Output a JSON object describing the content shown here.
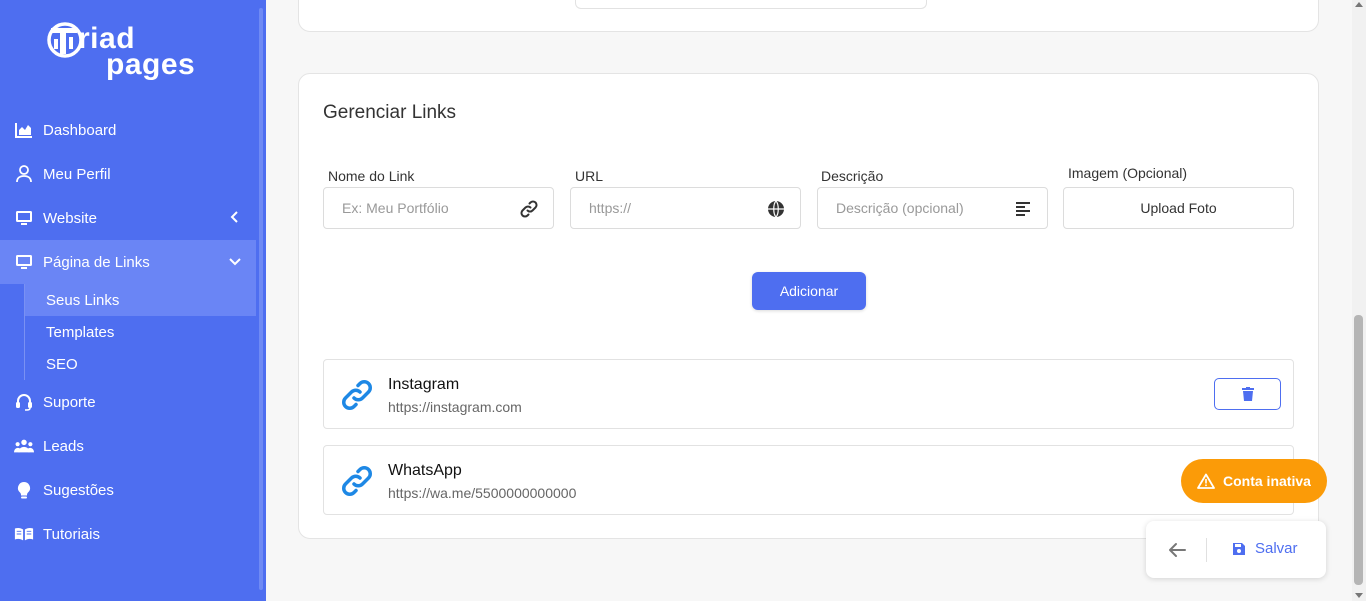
{
  "brand": {
    "line1": "riad",
    "line2": "pages",
    "logo_lettering": "Triad pages"
  },
  "sidebar": {
    "items": [
      {
        "label": "Dashboard",
        "icon": "chart-area-icon"
      },
      {
        "label": "Meu Perfil",
        "icon": "user-icon"
      },
      {
        "label": "Website",
        "icon": "monitor-icon"
      },
      {
        "label": "Página de Links",
        "icon": "monitor-icon"
      },
      {
        "label": "Suporte",
        "icon": "headset-icon"
      },
      {
        "label": "Leads",
        "icon": "users-icon"
      },
      {
        "label": "Sugestões",
        "icon": "lightbulb-icon"
      },
      {
        "label": "Tutoriais",
        "icon": "book-icon"
      }
    ],
    "subitems": [
      {
        "label": "Seus Links",
        "active": true
      },
      {
        "label": "Templates",
        "active": false
      },
      {
        "label": "SEO",
        "active": false
      }
    ]
  },
  "links_card": {
    "title": "Gerenciar Links",
    "fields": {
      "name_label": "Nome do Link",
      "name_placeholder": "Ex: Meu Portfólio",
      "url_label": "URL",
      "url_placeholder": "https://",
      "desc_label": "Descrição",
      "desc_placeholder": "Descrição (opcional)",
      "image_label": "Imagem (Opcional)",
      "upload_label": "Upload Foto"
    },
    "add_button": "Adicionar",
    "links": [
      {
        "name": "Instagram",
        "url": "https://instagram.com"
      },
      {
        "name": "WhatsApp",
        "url": "https://wa.me/5500000000000"
      }
    ]
  },
  "floating": {
    "warning": "Conta inativa",
    "save": "Salvar"
  },
  "colors": {
    "primary": "#4e6ef0",
    "sidebar_active": "#6a85f5",
    "warning": "#fb9b08",
    "link_icon": "#1e88e5"
  }
}
